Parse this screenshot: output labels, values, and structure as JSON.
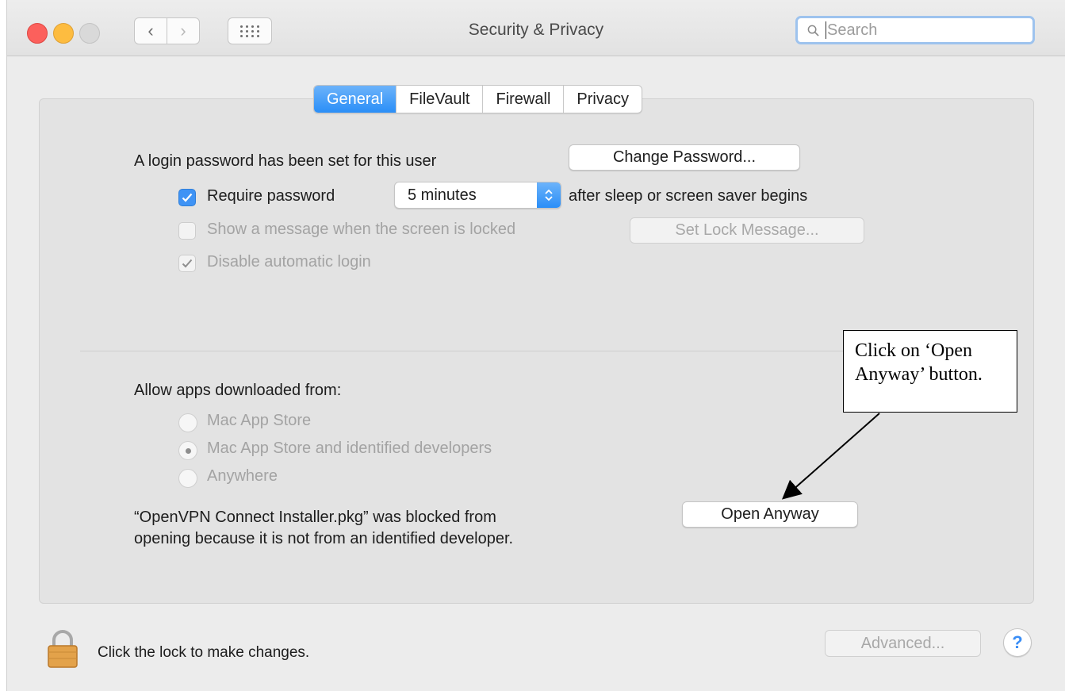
{
  "window": {
    "title": "Security & Privacy",
    "search_placeholder": "Search"
  },
  "tabs": [
    {
      "label": "General",
      "active": true
    },
    {
      "label": "FileVault",
      "active": false
    },
    {
      "label": "Firewall",
      "active": false
    },
    {
      "label": "Privacy",
      "active": false
    }
  ],
  "login": {
    "password_set_text": "A login password has been set for this user",
    "change_password_button": "Change Password...",
    "require_password_label": "Require password",
    "require_password_checked": true,
    "require_password_delay": "5 minutes",
    "after_sleep_text": "after sleep or screen saver begins",
    "show_message_label": "Show a message when the screen is locked",
    "show_message_checked": false,
    "set_lock_message_button": "Set Lock Message...",
    "disable_auto_login_label": "Disable automatic login",
    "disable_auto_login_checked": true
  },
  "downloads": {
    "heading": "Allow apps downloaded from:",
    "options": [
      {
        "label": "Mac App Store",
        "selected": false
      },
      {
        "label": "Mac App Store and identified developers",
        "selected": true
      },
      {
        "label": "Anywhere",
        "selected": false
      }
    ],
    "blocked_line1": "“OpenVPN Connect Installer.pkg” was blocked from",
    "blocked_line2": "opening because it is not from an identified developer.",
    "open_anyway_button": "Open Anyway"
  },
  "callout": {
    "line1": "Click on ‘Open",
    "line2": "Anyway’ button."
  },
  "footer": {
    "lock_text": "Click the lock to make changes.",
    "advanced_button": "Advanced...",
    "help_label": "?"
  },
  "colors": {
    "accent": "#2a8ef7",
    "close": "#fc605c",
    "minimize": "#fdbc40",
    "zoom_disabled": "#d9d9d9"
  }
}
